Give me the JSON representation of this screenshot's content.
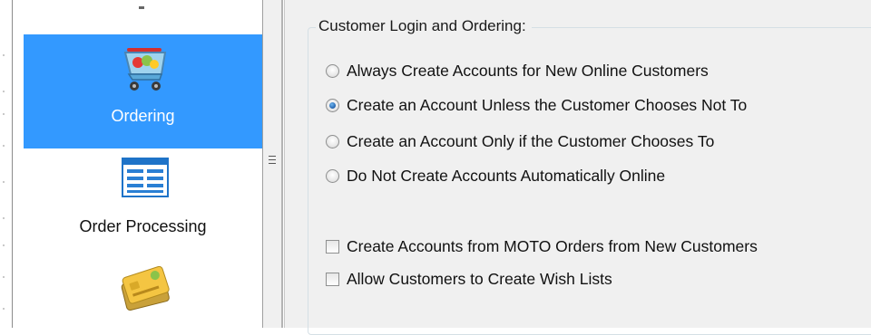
{
  "sidebar": {
    "items": [
      {
        "label": "Ordering",
        "icon": "shopping-cart-icon",
        "selected": true
      },
      {
        "label": "Order Processing",
        "icon": "form-list-icon",
        "selected": false
      },
      {
        "label": "",
        "icon": "credit-cards-icon",
        "selected": false
      }
    ]
  },
  "customer_login": {
    "title": "Customer Login and Ordering:",
    "radio_options": [
      {
        "label": "Always Create Accounts for New Online Customers",
        "checked": false
      },
      {
        "label": "Create an Account Unless the Customer Chooses Not To",
        "checked": true
      },
      {
        "label": "Create an Account Only if the Customer Chooses To",
        "checked": false
      },
      {
        "label": "Do Not Create Accounts Automatically Online",
        "checked": false
      }
    ],
    "checkboxes": [
      {
        "label": "Create Accounts from MOTO Orders from New Customers",
        "checked": false
      },
      {
        "label": "Allow Customers to Create Wish Lists",
        "checked": false
      }
    ]
  },
  "colors": {
    "selection": "#3399ff",
    "panel_background": "#f0f0f0",
    "radio_dot": "#1c5aa6"
  }
}
